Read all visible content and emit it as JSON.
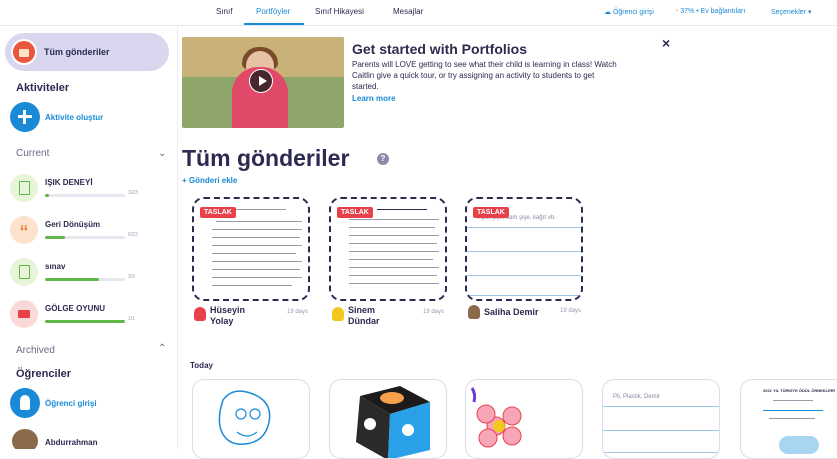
{
  "topnav": {
    "tabs": [
      {
        "label": "Sınıf"
      },
      {
        "label": "Portföyler"
      },
      {
        "label": "Sınıf Hikayesi"
      },
      {
        "label": "Mesajlar"
      }
    ],
    "student_login": "Öğrenci girişi",
    "connected": "37% • Ev bağlantıları",
    "options": "Seçenekler ▾"
  },
  "sidebar": {
    "all_posts": "Tüm gönderiler",
    "activities_title": "Aktiviteler",
    "create_activity": "Aktivite oluştur",
    "current_label": "Current",
    "activities": [
      {
        "name": "IŞIK DENEYİ",
        "count": "3/23",
        "progress": 0.05
      },
      {
        "name": "Geri Dönüşüm",
        "count": "6/22",
        "progress": 0.25
      },
      {
        "name": "sınav",
        "count": "2/3",
        "progress": 0.67
      },
      {
        "name": "GÖLGE OYUNU",
        "count": "1/1",
        "progress": 1.0
      }
    ],
    "archived_label": "Archived",
    "students_title": "Öğrenciler",
    "student_login": "Öğrenci girişi",
    "first_student": "Abdurrahman"
  },
  "promo": {
    "title": "Get started with Portfolios",
    "body": "Parents will LOVE getting to see what their child is learning in class! Watch Caitlin give a quick tour, or try assigning an activity to students to get started.",
    "link": "Learn more",
    "close": "×"
  },
  "main": {
    "page_title": "Tüm gönderiler",
    "help": "?",
    "add_post": "+ Gönderi ekle",
    "draft_label": "TASLAK",
    "posts": [
      {
        "author": "Hüseyin Yolay",
        "time": "19 days"
      },
      {
        "author": "Sinem Dündar",
        "time": "19 days"
      },
      {
        "author": "Saliha Demir",
        "time": "19 days",
        "text": "...pet şişe, cam şişe, kağıt vb."
      }
    ],
    "today_label": "Today",
    "today_cards": [
      {
        "kind": "drawing"
      },
      {
        "kind": "cube"
      },
      {
        "kind": "flower"
      },
      {
        "kind": "note",
        "text": "Pil, Plastik, Demir"
      },
      {
        "kind": "document",
        "text": "2021 YIL TÜRKİYE ÖDÜL ÖRNEKLERİ"
      }
    ]
  },
  "colors": {
    "accent": "#1a8ad6",
    "draft": "#e8414a",
    "progress": "#5fb845",
    "ink": "#2c2a50"
  }
}
